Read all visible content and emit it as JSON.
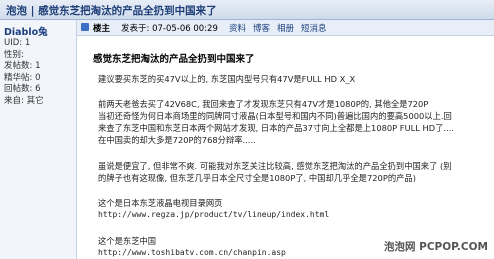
{
  "title_bar": {
    "text": "泡泡 | 感觉东芝把淘汰的产品全扔到中国来了"
  },
  "user": {
    "name": "Diablo兔",
    "info": [
      "UID: 1",
      "性别: ",
      "发帖数: 1",
      "精华帖: 0",
      "回帖数: 6",
      "来自: 其它"
    ]
  },
  "post_header": {
    "author_label": "楼主",
    "time": "发表于: 07-05-06 00:29",
    "tools": [
      "资料",
      "博客",
      "相册",
      "短消息"
    ]
  },
  "post": {
    "title": "感觉东芝把淘汰的产品全扔到中国来了",
    "p1": "建议要买东芝的买47V以上的, 东芝国内型号只有47V是FULL HD  X_X",
    "p2": [
      "前两天老爸去买了42V68C, 我回来查了才发现东芝只有47V才是1080P的, 其他全是720P",
      "当初还奇怪为何日本商场里的同牌同寸液晶(日本型号和国内不同)普遍比国内的要高5000以上.回",
      "来查了东芝中国和东芝日本两个网站才发现, 日本的产品37寸向上全都是上1080P  FULL HD了....",
      "在中国卖的却大多是720P的768分辩率....."
    ],
    "p3": [
      "虽说是便宜了, 但非常不爽. 可能我对东芝关注比较高, 感觉东芝把淘汰的产品全扔到中国来了 (别",
      "的牌子也有这现像, 但东芝几乎日本全尺寸全是1080P了, 中国却几乎全是720P的产品)"
    ],
    "link1_label": "这个是日本东芝液晶电视目录网页",
    "link1_url": "http://www.regza.jp/product/tv/lineup/index.html",
    "link2_label": "这个是东芝中国",
    "link2_url": "http://www.toshibatv.com.cn/chanpin.asp"
  },
  "watermark": "泡泡网 PCPOP.COM"
}
